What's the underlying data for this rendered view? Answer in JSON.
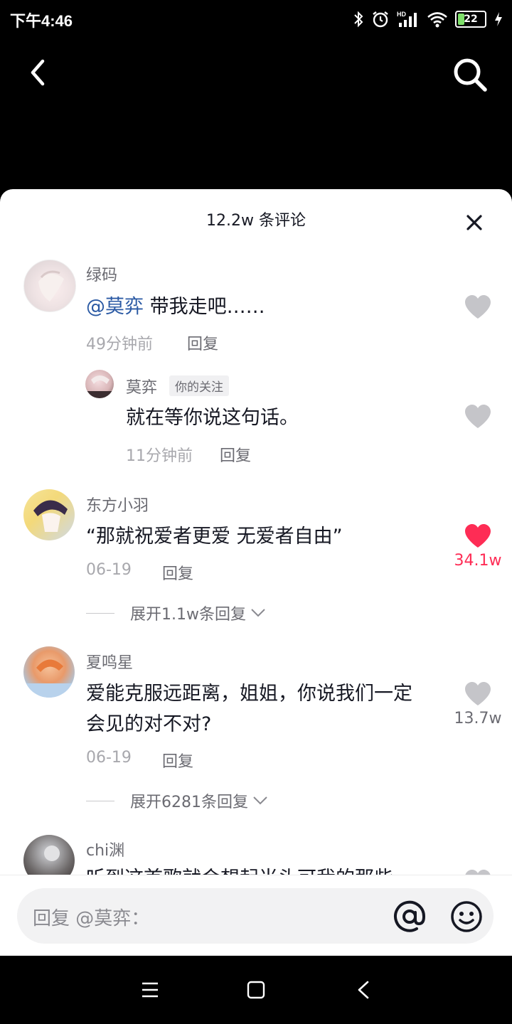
{
  "status_bar": {
    "time": "下午4:46",
    "battery": "22"
  },
  "header": {
    "comment_count": "12.2w 条评论"
  },
  "comments": [
    {
      "username": "绿码",
      "mention": "@莫弈",
      "text": " 带我走吧……",
      "time": "49分钟前",
      "reply_label": "回复",
      "replies": [
        {
          "username": "莫弈",
          "tag": "你的关注",
          "text": "就在等你说这句话。",
          "time": "11分钟前",
          "reply_label": "回复"
        }
      ]
    },
    {
      "username": "东方小羽",
      "text": "“那就祝爱者更爱 无爱者自由”",
      "time": "06-19",
      "reply_label": "回复",
      "likes": "34.1w",
      "liked": true,
      "expand": "展开1.1w条回复"
    },
    {
      "username": "夏鸣星",
      "text_line1": "爱能克服远距离，姐姐，你说我们一定",
      "text_line2": "会见的对不对?",
      "time": "06-19",
      "reply_label": "回复",
      "likes": "13.7w",
      "expand": "展开6281条回复"
    },
    {
      "username": "chi渊",
      "text": "听到这首歌就会想起当头可我的那些"
    }
  ],
  "input": {
    "placeholder": "回复 @莫弈："
  },
  "colors": {
    "accent_red": "#fe2c55",
    "mention_blue": "#2b5aa4"
  },
  "icons": [
    "back-arrow-icon",
    "search-icon",
    "close-icon",
    "heart-icon",
    "chevron-down-icon",
    "at-icon",
    "emoji-icon",
    "menu-icon",
    "home-square-icon",
    "back-triangle-icon"
  ]
}
